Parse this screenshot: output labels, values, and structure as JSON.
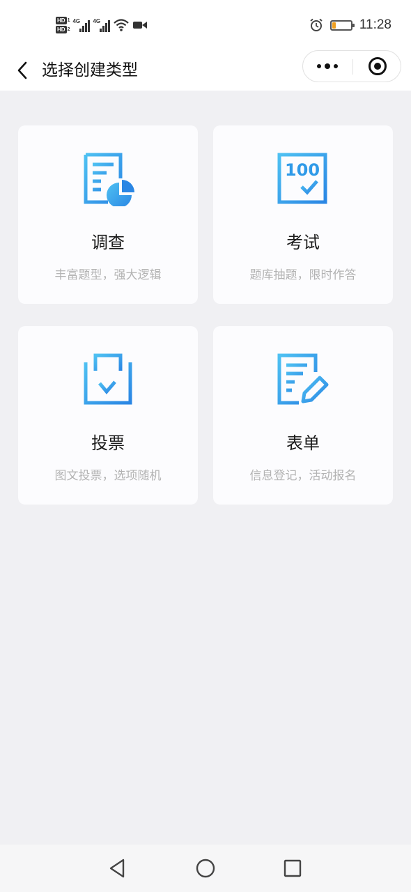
{
  "status_bar": {
    "time": "11:28",
    "hd1": "HD",
    "hd1_num": "1",
    "hd2": "HD",
    "hd2_num": "2",
    "net1": "4G",
    "net2": "4G",
    "battery_level": 0.2,
    "battery_color": "#f0a020",
    "icons": [
      "signal-icon",
      "wifi-icon",
      "video-icon",
      "alarm-icon",
      "battery-icon"
    ]
  },
  "nav": {
    "title": "选择创建类型",
    "back_icon": "chevron-left-icon",
    "more_icon": "more-dots-icon",
    "close_icon": "target-circle-icon"
  },
  "accent_color": "#2f9ae8",
  "cards": [
    {
      "title": "调查",
      "desc": "丰富题型，强大逻辑",
      "icon": "survey-icon"
    },
    {
      "title": "考试",
      "desc": "题库抽题，限时作答",
      "icon": "exam-icon"
    },
    {
      "title": "投票",
      "desc": "图文投票，选项随机",
      "icon": "vote-icon"
    },
    {
      "title": "表单",
      "desc": "信息登记，活动报名",
      "icon": "form-icon"
    }
  ],
  "exam_icon_text": "100",
  "system_nav": {
    "icons": [
      "back-triangle-icon",
      "home-circle-icon",
      "recents-square-icon"
    ]
  }
}
